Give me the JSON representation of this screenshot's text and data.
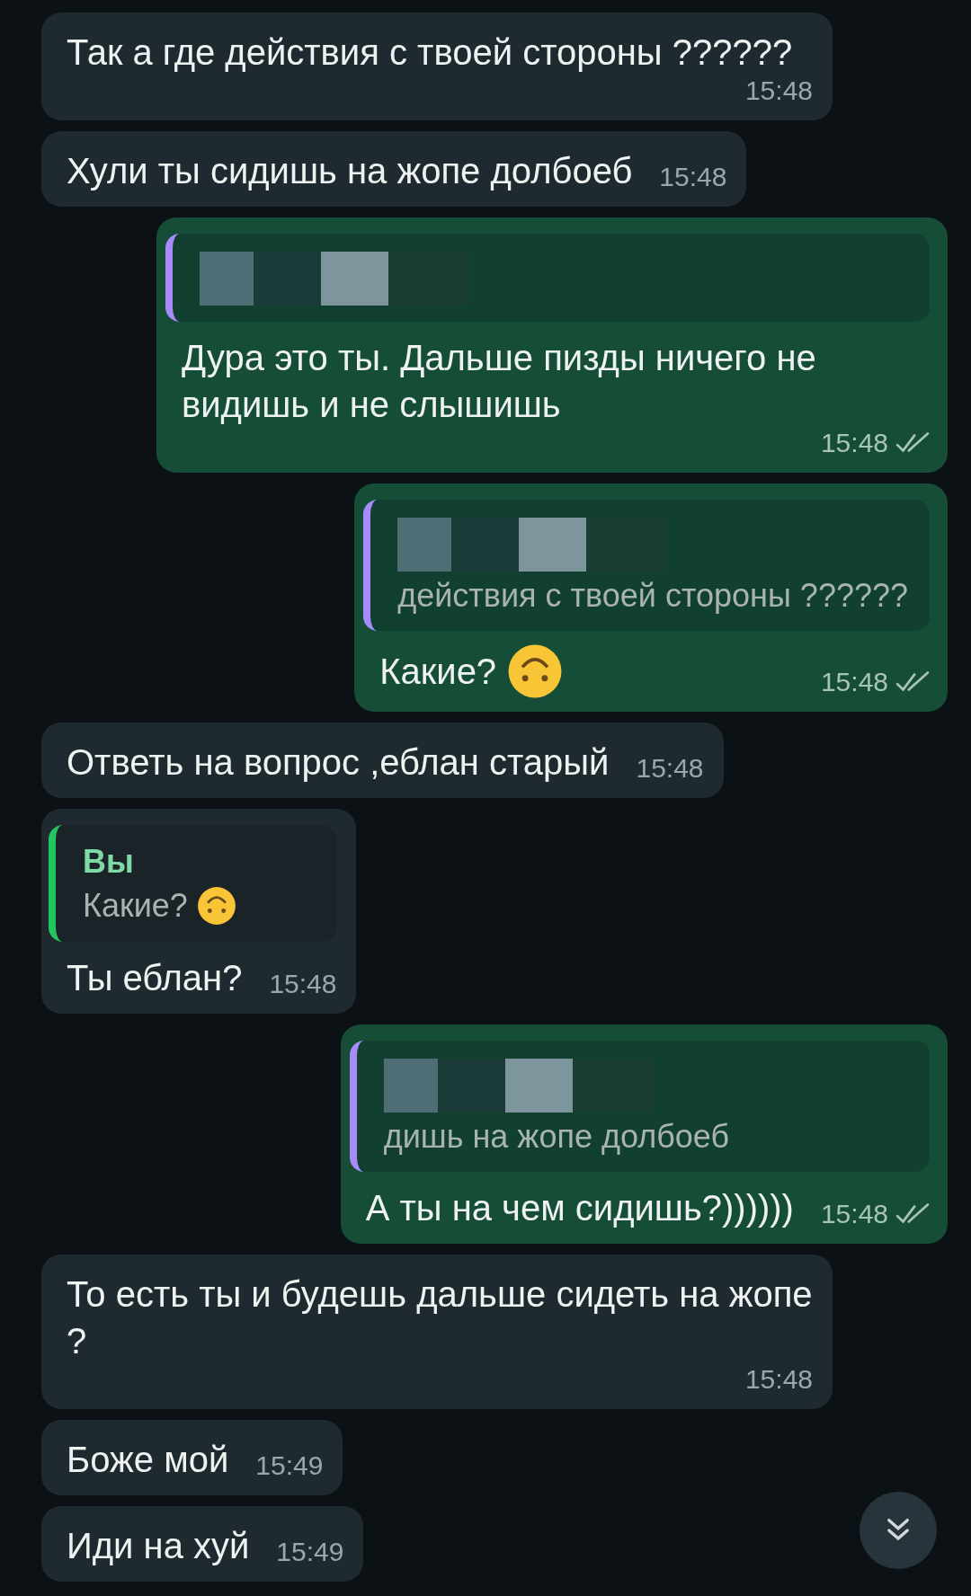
{
  "messages": [
    {
      "kind": "in",
      "text": "Так а где действия с твоей стороны ??????",
      "time": "15:48"
    },
    {
      "kind": "in",
      "text": "Хули ты сидишь на жопе долбоеб",
      "time": "15:48"
    },
    {
      "kind": "out",
      "text": "Дура это ты. Дальше пизды ничего не видишь и не слышишь",
      "time": "15:48",
      "quote": {
        "censored": true
      }
    },
    {
      "kind": "out",
      "text": "Какие?",
      "emoji": true,
      "time": "15:48",
      "quote": {
        "censored": true,
        "text": "действия с твоей стороны ??????"
      }
    },
    {
      "kind": "in",
      "text": "Ответь на вопрос ,еблан старый",
      "time": "15:48"
    },
    {
      "kind": "in",
      "text": "Ты еблан?",
      "time": "15:48",
      "quote": {
        "author": "Вы",
        "text": "Какие?",
        "emoji": true
      }
    },
    {
      "kind": "out",
      "text": "А ты на чем сидишь?))))))",
      "time": "15:48",
      "quote": {
        "censored": true,
        "text": "дишь на жопе долбоеб"
      }
    },
    {
      "kind": "in",
      "text": "То есть ты и будешь дальше сидеть на жопе ?",
      "time": "15:48"
    },
    {
      "kind": "in",
      "text": "Боже мой",
      "time": "15:49"
    },
    {
      "kind": "in",
      "text": "Иди на хуй",
      "time": "15:49"
    }
  ]
}
